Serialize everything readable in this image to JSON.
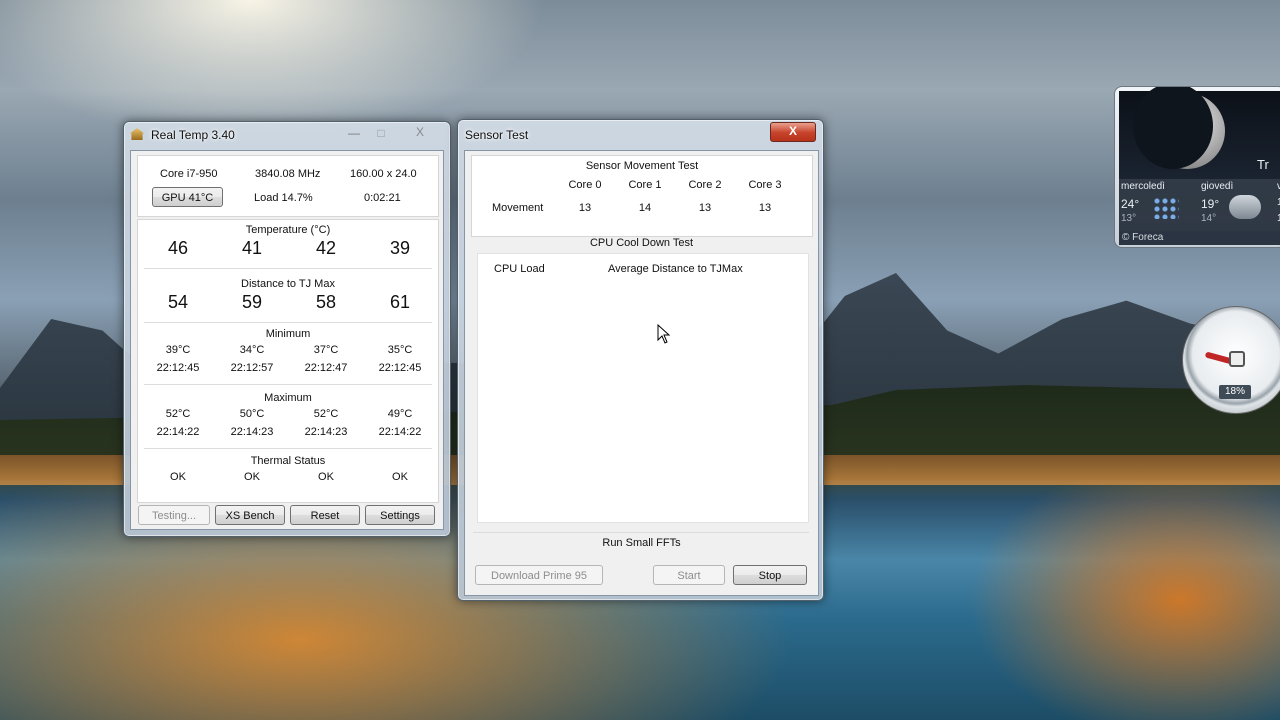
{
  "realtemp": {
    "title": "Real Temp 3.40",
    "cpu_model": "Core i7-950",
    "freq": "3840.08 MHz",
    "multiplier": "160.00 x 24.0",
    "gpu_button": "GPU  41°C",
    "load": "Load  14.7%",
    "uptime": "0:02:21",
    "temp_header": "Temperature (°C)",
    "temps": [
      "46",
      "41",
      "42",
      "39"
    ],
    "dist_header": "Distance to TJ Max",
    "dist": [
      "54",
      "59",
      "58",
      "61"
    ],
    "min_header": "Minimum",
    "min_temps": [
      "39°C",
      "34°C",
      "37°C",
      "35°C"
    ],
    "min_times": [
      "22:12:45",
      "22:12:57",
      "22:12:47",
      "22:12:45"
    ],
    "max_header": "Maximum",
    "max_temps": [
      "52°C",
      "50°C",
      "52°C",
      "49°C"
    ],
    "max_times": [
      "22:14:22",
      "22:14:23",
      "22:14:23",
      "22:14:22"
    ],
    "thermal_header": "Thermal Status",
    "thermal": [
      "OK",
      "OK",
      "OK",
      "OK"
    ],
    "buttons": {
      "testing": "Testing...",
      "xs_bench": "XS Bench",
      "reset": "Reset",
      "settings": "Settings"
    }
  },
  "sensortest": {
    "title": "Sensor Test",
    "movement_header": "Sensor Movement Test",
    "cores": [
      "Core 0",
      "Core 1",
      "Core 2",
      "Core 3"
    ],
    "movement_label": "Movement",
    "movement": [
      "13",
      "14",
      "13",
      "13"
    ],
    "cooldown_header": "CPU Cool Down Test",
    "cpu_load_label": "CPU Load",
    "avg_dist_label": "Average Distance to TJMax",
    "run_label": "Run Small FFTs",
    "buttons": {
      "download": "Download Prime 95",
      "start": "Start",
      "stop": "Stop"
    }
  },
  "weather": {
    "partial_label": "Tr",
    "days": [
      "mercoledì",
      "giovedì"
    ],
    "day_temps": [
      [
        "24°",
        "13°"
      ],
      [
        "19°",
        "14°"
      ]
    ],
    "partial_col": [
      "v",
      "1",
      "1"
    ],
    "footer": "© Foreca"
  },
  "gauge": {
    "value": "18%"
  },
  "close_glyph": "X",
  "min_glyph": "—",
  "max_glyph": "□"
}
